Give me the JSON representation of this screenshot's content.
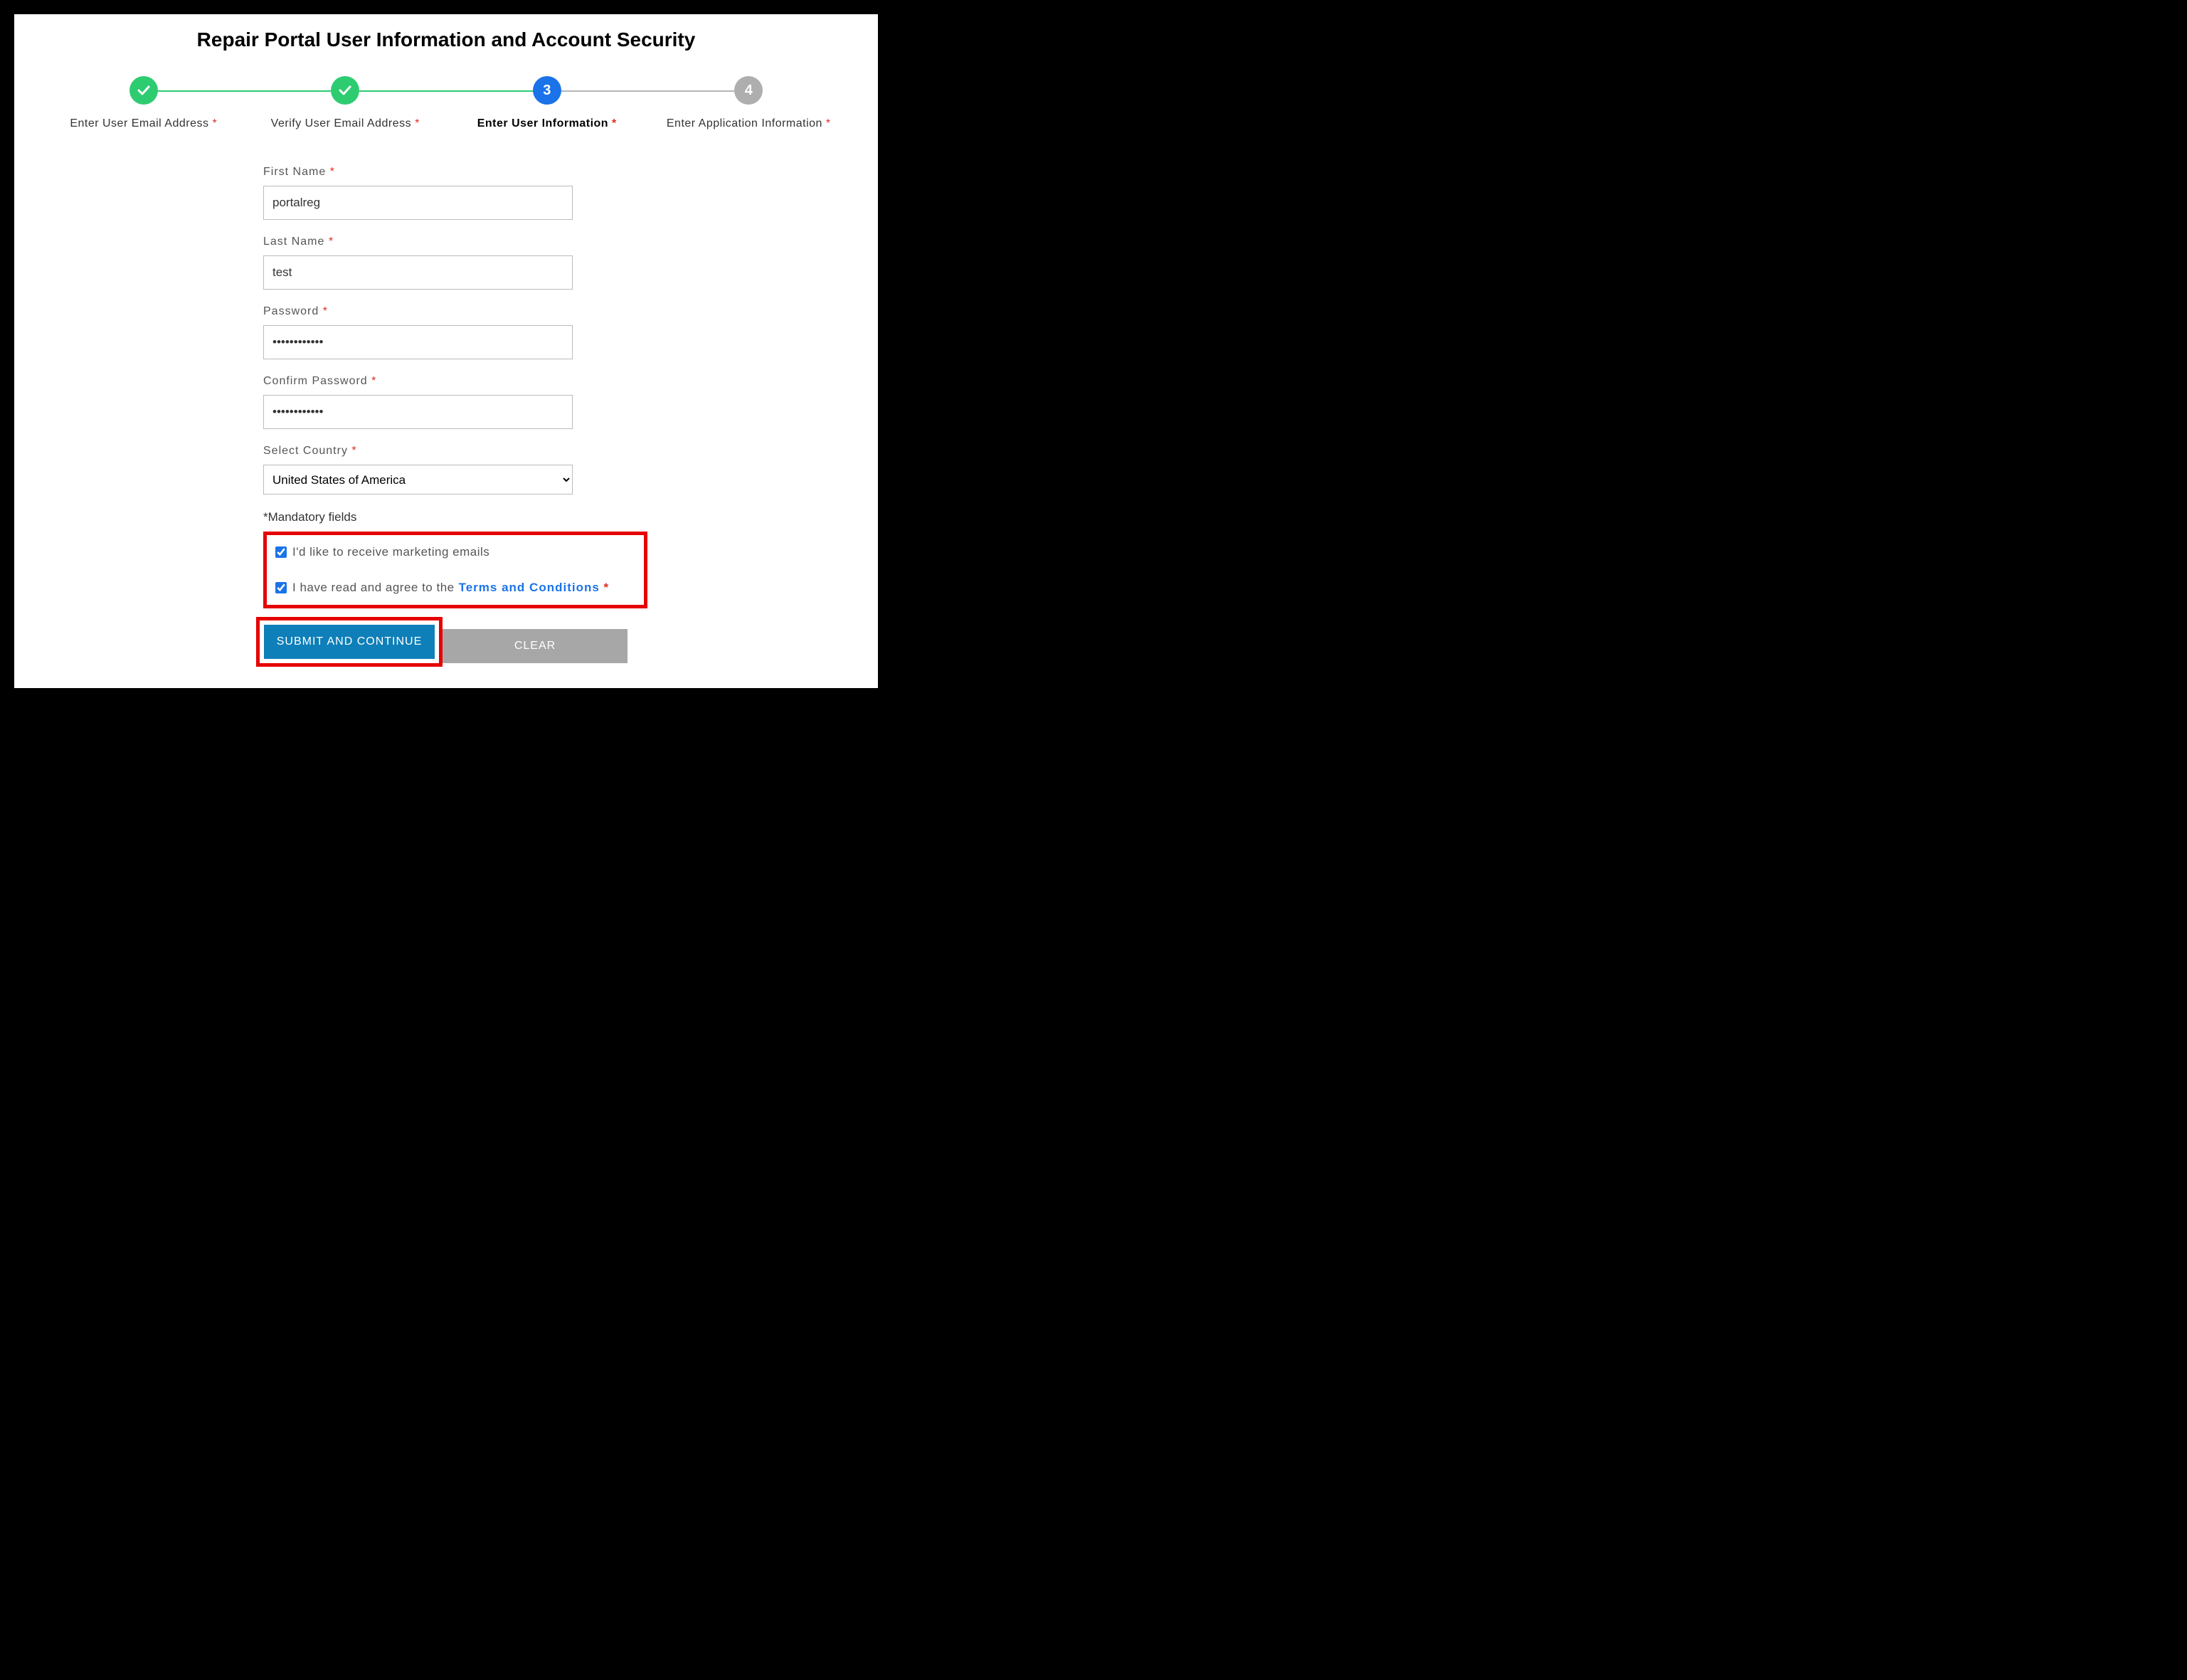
{
  "title": "Repair Portal User Information and Account Security",
  "steps": [
    {
      "label": "Enter User Email Address",
      "star": "*"
    },
    {
      "label": "Verify User Email Address",
      "star": "*"
    },
    {
      "label": "Enter User Information",
      "star": "*",
      "num": "3"
    },
    {
      "label": "Enter Application Information",
      "star": "*",
      "num": "4"
    }
  ],
  "form": {
    "first_name_label": "First Name",
    "first_name_value": "portalreg",
    "last_name_label": "Last Name",
    "last_name_value": "test",
    "password_label": "Password",
    "password_value": "••••••••••••",
    "confirm_password_label": "Confirm Password",
    "confirm_password_value": "••••••••••••",
    "country_label": "Select Country",
    "country_value": "United States of America",
    "mandatory_note": "*Mandatory fields",
    "marketing_label": "I'd like to receive marketing emails",
    "terms_prefix": "I have read and agree to the",
    "terms_link": "Terms and Conditions",
    "star": "*"
  },
  "buttons": {
    "submit": "SUBMIT AND CONTINUE",
    "clear": "CLEAR"
  }
}
